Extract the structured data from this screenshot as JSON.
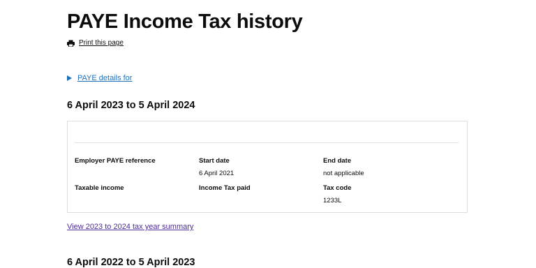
{
  "page": {
    "title": "PAYE Income Tax history",
    "print_label": "Print this page",
    "details_label": "PAYE details for"
  },
  "years": [
    {
      "heading": "6 April 2023 to 5 April 2024",
      "fields": {
        "employer_ref_label": "Employer PAYE reference",
        "start_date_label": "Start date",
        "start_date_value": "6 April 2021",
        "end_date_label": "End date",
        "end_date_value": "not applicable",
        "taxable_income_label": "Taxable income",
        "income_tax_paid_label": "Income Tax paid",
        "tax_code_label": "Tax code",
        "tax_code_value": "1233L"
      },
      "summary_link": "View 2023 to 2024 tax year summary"
    },
    {
      "heading": "6 April 2022 to 5 April 2023"
    }
  ],
  "colors": {
    "link": "#1d70b8",
    "visited_link": "#4c2c92",
    "text": "#0b0c0c"
  }
}
